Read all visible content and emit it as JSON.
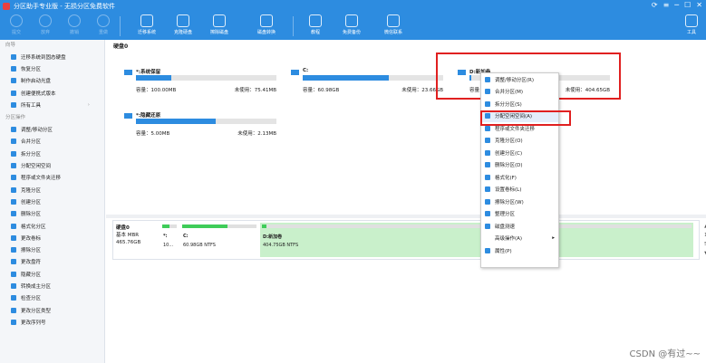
{
  "window": {
    "title": "分区助手专业版 - 无损分区免费软件",
    "controls": [
      "⟳",
      "≡",
      "─",
      "☐",
      "✕"
    ]
  },
  "toolbar": {
    "buttons": [
      {
        "label": "提交",
        "enabled": false
      },
      {
        "label": "放弃",
        "enabled": false
      },
      {
        "label": "撤销",
        "enabled": false
      },
      {
        "label": "重做",
        "enabled": false
      },
      {
        "label": "迁移系统",
        "enabled": true
      },
      {
        "label": "克隆硬盘",
        "enabled": true
      },
      {
        "label": "擦除磁盘",
        "enabled": true
      },
      {
        "label": "磁盘转换",
        "enabled": true
      },
      {
        "label": "教程",
        "enabled": true
      },
      {
        "label": "免费备份",
        "enabled": true
      },
      {
        "label": "微信联系",
        "enabled": true
      },
      {
        "label": "工具",
        "enabled": true
      }
    ]
  },
  "sidebar": {
    "wizard_title": "向导",
    "wizard_items": [
      {
        "label": "迁移系统到固态硬盘"
      },
      {
        "label": "恢复分区"
      },
      {
        "label": "制作启动光盘"
      },
      {
        "label": "创建便携式版本"
      },
      {
        "label": "所有工具",
        "arrow": "›"
      }
    ],
    "ops_title": "分区操作",
    "ops_items": [
      {
        "label": "调整/移动分区"
      },
      {
        "label": "合并分区"
      },
      {
        "label": "拆分分区"
      },
      {
        "label": "分配空闲空间"
      },
      {
        "label": "程序或文件夹迁移"
      },
      {
        "label": "克隆分区"
      },
      {
        "label": "创建分区"
      },
      {
        "label": "删除分区"
      },
      {
        "label": "格式化分区"
      },
      {
        "label": "更改卷标"
      },
      {
        "label": "擦除分区"
      },
      {
        "label": "更改盘符"
      },
      {
        "label": "隐藏分区"
      },
      {
        "label": "转换成主分区"
      },
      {
        "label": "检查分区"
      },
      {
        "label": "更改分区类型"
      },
      {
        "label": "更改序列号"
      }
    ]
  },
  "main": {
    "disk_title": "硬盘0",
    "partitions": [
      {
        "name": "*:系统保留",
        "capacity": "容量：100.00MB",
        "free": "未使用：75.41MB",
        "used_fraction": 0.25
      },
      {
        "name": "C:",
        "capacity": "容量：60.98GB",
        "free": "未使用：23.66GB",
        "used_fraction": 0.61
      },
      {
        "name": "D:新加卷",
        "capacity": "容量：40",
        "free": "未使用：404.65GB",
        "used_fraction": 0.01
      },
      {
        "name": "*:隐藏还原",
        "capacity": "容量：5.00MB",
        "free": "未使用：2.13MB",
        "used_fraction": 0.57
      }
    ],
    "disk_row": {
      "title": "硬盘0",
      "type_label": "基本",
      "type_value": "MBR",
      "size": "465.76GB",
      "segments": [
        {
          "l1": "*:",
          "l2": "10...",
          "fill": 0.5
        },
        {
          "l1": "*:",
          "l2": "10...",
          "fill": 0.5
        },
        {
          "l1": "C:",
          "l2": "60.98GB NTFS",
          "fill": 0.61
        },
        {
          "l1": "D:新加卷",
          "l2": "404.75GB NTFS",
          "fill": 0.01
        }
      ],
      "scroll_chars": [
        "▲",
        "1",
        "5",
        "▼"
      ]
    }
  },
  "context_menu": {
    "items": [
      {
        "label": "调整/移动分区(R)"
      },
      {
        "label": "合并分区(M)"
      },
      {
        "label": "拆分分区(S)"
      },
      {
        "label": "分配空闲空间(A)",
        "highlight": true
      },
      {
        "label": "程序或文件夹迁移"
      },
      {
        "label": "克隆分区(O)"
      },
      {
        "label": "创建分区(C)"
      },
      {
        "label": "删除分区(D)"
      },
      {
        "label": "格式化(F)"
      },
      {
        "label": "设置卷标(L)"
      },
      {
        "label": "擦除分区(W)"
      },
      {
        "label": "整理分区"
      },
      {
        "label": "磁盘测速"
      },
      {
        "label": "高级操作(A)",
        "submenu": true,
        "arrow": "▸"
      },
      {
        "label": "属性(P)"
      }
    ]
  },
  "watermark": "CSDN @有过~~",
  "colors": {
    "accent": "#2d8ce0",
    "used_green": "#3fcc59",
    "partition_green": "#c9f0cb",
    "highlight_red": "#e02020"
  }
}
